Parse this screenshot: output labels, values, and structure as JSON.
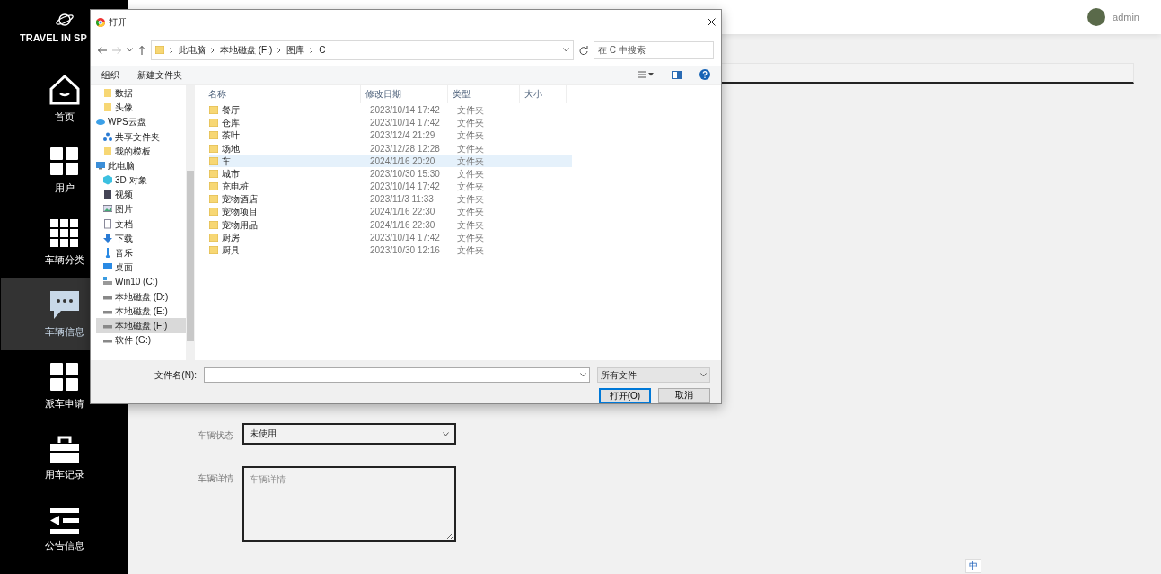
{
  "sidebar": {
    "brand": "TRAVEL IN SP",
    "items": [
      {
        "label": "首页",
        "kind": "home",
        "selected": false
      },
      {
        "label": "用户",
        "kind": "grid4",
        "selected": false
      },
      {
        "label": "车辆分类",
        "kind": "grid9",
        "selected": false
      },
      {
        "label": "车辆信息",
        "kind": "chat",
        "selected": true
      },
      {
        "label": "派车申请",
        "kind": "grid4",
        "selected": false
      },
      {
        "label": "用车记录",
        "kind": "briefcase",
        "selected": false
      },
      {
        "label": "公告信息",
        "kind": "list",
        "selected": false
      }
    ]
  },
  "header": {
    "user": "admin"
  },
  "form": {
    "fields": [
      {
        "kind": "select",
        "label": "车辆状态",
        "value": "未使用"
      },
      {
        "kind": "textarea",
        "label": "车辆详情",
        "placeholder": "车辆详情"
      }
    ]
  },
  "dialog": {
    "title": "打开",
    "path": [
      "此电脑",
      "本地磁盘 (F:)",
      "图库",
      "C"
    ],
    "search": {
      "placeholder": "在 C 中搜索"
    },
    "toolbar": [
      "组织",
      "新建文件夹"
    ],
    "tree": [
      {
        "children": [
          {
            "label": "数据",
            "kind": "folder",
            "selected": false
          },
          {
            "label": "头像",
            "kind": "folder",
            "selected": false
          }
        ]
      },
      {
        "label": "WPS云盘",
        "kind": "cloud",
        "selected": false,
        "children": [
          {
            "label": "共享文件夹",
            "kind": "share",
            "selected": false
          },
          {
            "label": "我的模板",
            "kind": "folder",
            "selected": false
          }
        ]
      },
      {
        "label": "此电脑",
        "kind": "pc",
        "selected": false,
        "children": [
          {
            "label": "3D 对象",
            "kind": "cube",
            "selected": false
          },
          {
            "label": "视频",
            "kind": "video",
            "selected": false
          },
          {
            "label": "图片",
            "kind": "image",
            "selected": false
          },
          {
            "label": "文档",
            "kind": "doc",
            "selected": false
          },
          {
            "label": "下载",
            "kind": "download",
            "selected": false
          },
          {
            "label": "音乐",
            "kind": "music",
            "selected": false
          },
          {
            "label": "桌面",
            "kind": "desktop",
            "selected": false
          },
          {
            "label": "Win10 (C:)",
            "kind": "windrive",
            "selected": false
          },
          {
            "label": "本地磁盘 (D:)",
            "kind": "drive",
            "selected": false
          },
          {
            "label": "本地磁盘 (E:)",
            "kind": "drive",
            "selected": false
          },
          {
            "label": "本地磁盘 (F:)",
            "kind": "drive",
            "selected": true
          },
          {
            "label": "软件 (G:)",
            "kind": "drive",
            "selected": false
          }
        ]
      }
    ],
    "columns": [
      "名称",
      "修改日期",
      "类型",
      "大小"
    ],
    "files": [
      {
        "name": "餐厅",
        "date": "2023/10/14 17:42",
        "type": "文件夹",
        "selected": false
      },
      {
        "name": "仓库",
        "date": "2023/10/14 17:42",
        "type": "文件夹",
        "selected": false
      },
      {
        "name": "茶叶",
        "date": "2023/12/4 21:29",
        "type": "文件夹",
        "selected": false
      },
      {
        "name": "场地",
        "date": "2023/12/28 12:28",
        "type": "文件夹",
        "selected": false
      },
      {
        "name": "车",
        "date": "2024/1/16 20:20",
        "type": "文件夹",
        "selected": true
      },
      {
        "name": "城市",
        "date": "2023/10/30 15:30",
        "type": "文件夹",
        "selected": false
      },
      {
        "name": "充电桩",
        "date": "2023/10/14 17:42",
        "type": "文件夹",
        "selected": false
      },
      {
        "name": "宠物酒店",
        "date": "2023/11/3 11:33",
        "type": "文件夹",
        "selected": false
      },
      {
        "name": "宠物项目",
        "date": "2024/1/16 22:30",
        "type": "文件夹",
        "selected": false
      },
      {
        "name": "宠物用品",
        "date": "2024/1/16 22:30",
        "type": "文件夹",
        "selected": false
      },
      {
        "name": "厨房",
        "date": "2023/10/14 17:42",
        "type": "文件夹",
        "selected": false
      },
      {
        "name": "厨具",
        "date": "2023/10/30 12:16",
        "type": "文件夹",
        "selected": false
      }
    ],
    "filename_label": "文件名(N):",
    "filter": "所有文件",
    "buttons": [
      "打开(O)",
      "取消"
    ]
  },
  "ime": {
    "label": "中"
  }
}
